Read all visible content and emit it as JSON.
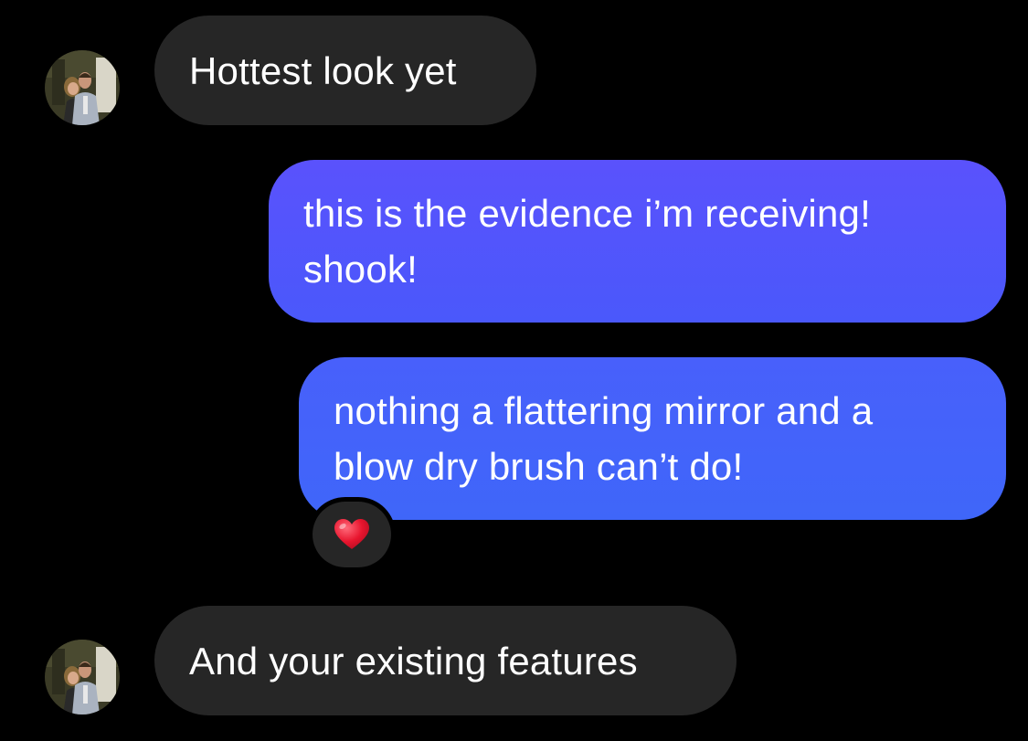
{
  "messages": [
    {
      "direction": "incoming",
      "lines": [
        "Hottest look yet"
      ]
    },
    {
      "direction": "outgoing",
      "lines": [
        "this is the evidence i’m receiving!",
        "shook!"
      ]
    },
    {
      "direction": "outgoing",
      "lines": [
        "nothing a flattering mirror and a",
        "blow dry brush can’t do!"
      ]
    },
    {
      "direction": "incoming",
      "lines": [
        "And your existing features"
      ]
    }
  ],
  "reaction": {
    "icon": "heart-icon"
  },
  "avatar": {
    "icon": "profile-photo-avatar"
  },
  "colors": {
    "background": "#000000",
    "incoming_bubble": "#262626",
    "outgoing_bubble_top": "#5a52fc",
    "outgoing_bubble_bottom": "#3f66f9",
    "heart": "#e8152e"
  }
}
